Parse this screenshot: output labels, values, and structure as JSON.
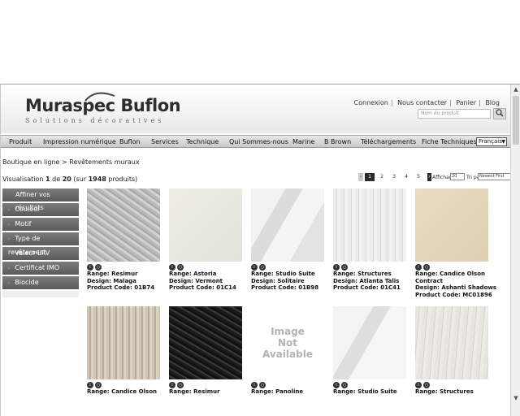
{
  "header": {
    "brand_left": "Muraspec",
    "brand_right": "Buflon",
    "tagline": "Solutions décoratives",
    "links": [
      "Connexion",
      "Nous contacter",
      "Panier",
      "Blog"
    ],
    "search_placeholder": "Nom du produit",
    "search_icon": "search-icon"
  },
  "nav": {
    "items": [
      "Produit",
      "Impression numérique",
      "Buflon",
      "Services",
      "Technique",
      "Qui Sommes-nous",
      "Marine",
      "B Brown",
      "Téléchargements",
      "Fiche Techniques"
    ],
    "language": "Français"
  },
  "breadcrumb": "Boutique en ligne > Revêtements muraux",
  "results": {
    "prefix": "Visualisation",
    "from": "1",
    "de": "de",
    "to": "20",
    "suffix_open": "(sur",
    "total": "1948",
    "suffix_close": "produits)"
  },
  "pager": {
    "pages": [
      "1",
      "2",
      "3",
      "4",
      "5"
    ],
    "display_label": "Affichage",
    "per_page": "20",
    "sort_label": "Tri par",
    "sort_value": "Newest First"
  },
  "filters": {
    "title": "Affiner vos résultats",
    "items": [
      "Couleur",
      "Motif",
      "Type de revêtement",
      "Valeur LRV",
      "Certificat IMO",
      "Biocide"
    ]
  },
  "products": [
    {
      "lines": [
        "Range: Resimur",
        "Design: Malaga",
        "Product Code: 01B74"
      ]
    },
    {
      "lines": [
        "Range: Astoria",
        "Design: Vermont",
        "Product Code: 01C14"
      ]
    },
    {
      "lines": [
        "Range: Studio Suite",
        "Design: Solitaire",
        "Product Code: 01B98"
      ]
    },
    {
      "lines": [
        "Range: Structures",
        "Design: Atlanta Talis",
        "Product Code: 01C41"
      ]
    },
    {
      "lines": [
        "Range: Candice Olson",
        "Contract",
        "Design: Ashanti Shadows",
        "Product Code: MC01896"
      ]
    },
    {
      "lines": [
        "Range: Candice Olson"
      ]
    },
    {
      "lines": [
        "Range: Resimur"
      ]
    },
    {
      "lines": [
        "Range: Panoline"
      ],
      "image_text": [
        "Image",
        "Not",
        "Available"
      ]
    },
    {
      "lines": [
        "Range: Studio Suite"
      ]
    },
    {
      "lines": [
        "Range: Structures"
      ]
    }
  ],
  "colors": {
    "filter_bg": "#6a6a6a",
    "nav_bg": "#d6d6d6",
    "pager_current": "#2a2a2a"
  }
}
